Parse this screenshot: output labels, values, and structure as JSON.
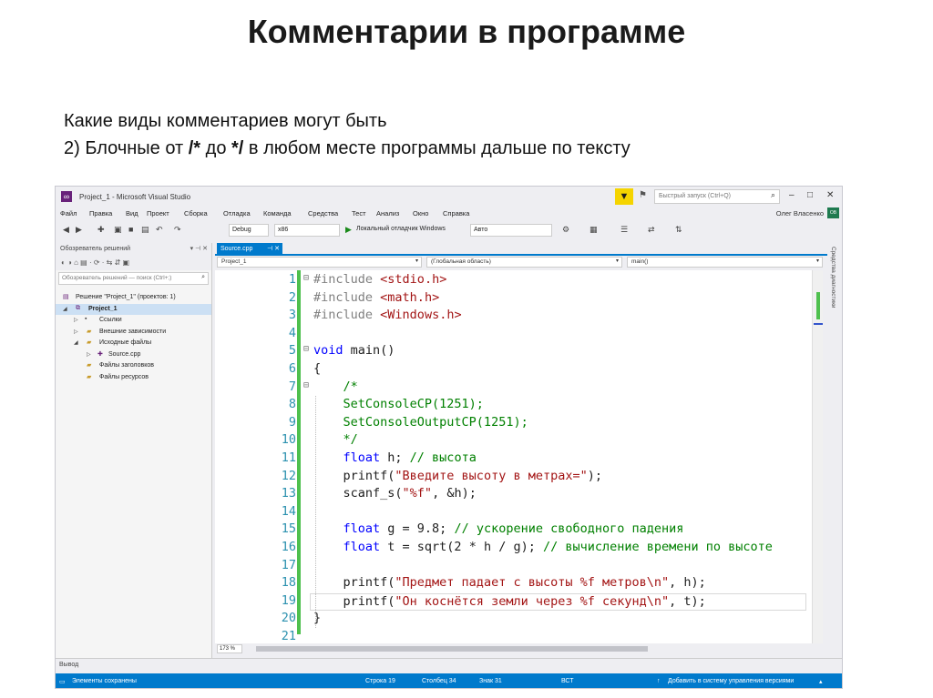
{
  "slide": {
    "title": "Комментарии в программе",
    "line1": "Какие виды комментариев могут быть",
    "line2_prefix": "2) Блочные от ",
    "line2_open": "/*",
    "line2_mid": " до ",
    "line2_close": "*/",
    "line2_suffix": " в любом месте программы дальше по тексту"
  },
  "window": {
    "title": "Project_1 - Microsoft Visual Studio",
    "quick_launch_placeholder": "Быстрый запуск (Ctrl+Q)",
    "user": "Олег Власенко",
    "user_badge": "OB"
  },
  "menu": [
    "Файл",
    "Правка",
    "Вид",
    "Проект",
    "Сборка",
    "Отладка",
    "Команда",
    "Средства",
    "Тест",
    "Анализ",
    "Окно",
    "Справка"
  ],
  "toolbar": {
    "config": "Debug",
    "platform": "x86",
    "run_label": "Локальный отладчик Windows",
    "run_mode": "Авто"
  },
  "solution_explorer": {
    "title": "Обозреватель решений",
    "search_placeholder": "Обозреватель решений — поиск (Ctrl+;)",
    "items": [
      {
        "label": "Решение \"Project_1\" (проектов: 1)",
        "level": 0
      },
      {
        "label": "Project_1",
        "level": 1,
        "bold": true,
        "selected": true
      },
      {
        "label": "Ссылки",
        "level": 2
      },
      {
        "label": "Внешние зависимости",
        "level": 2
      },
      {
        "label": "Исходные файлы",
        "level": 2
      },
      {
        "label": "Source.cpp",
        "level": 3
      },
      {
        "label": "Файлы заголовков",
        "level": 2
      },
      {
        "label": "Файлы ресурсов",
        "level": 2
      }
    ]
  },
  "editor": {
    "tab": "Source.cpp",
    "nav_project": "Project_1",
    "nav_scope": "(Глобальная область)",
    "nav_member": "main()",
    "zoom": "173 %"
  },
  "side_tab": "Средства диагностики",
  "output_label": "Вывод",
  "status": {
    "left": "Элементы сохранены",
    "row": "Строка 19",
    "col": "Столбец 34",
    "ch": "Знак 31",
    "mode": "ВСТ",
    "vcs": "Добавить в систему управления версиями"
  }
}
